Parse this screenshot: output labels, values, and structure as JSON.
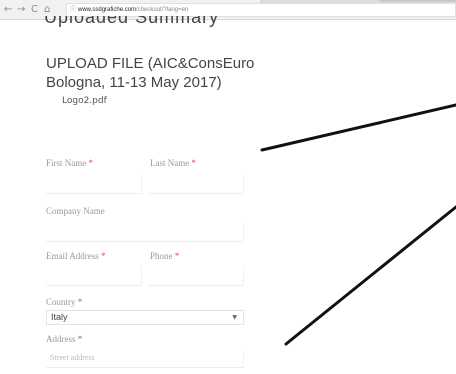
{
  "browser": {
    "back_icon": "←",
    "forward_icon": "→",
    "reload_icon": "C",
    "home_icon": "⌂",
    "info_icon": "ⓘ",
    "url_domain": "www.ssdgrafiche.com",
    "url_path": "/checkout/?lang=en"
  },
  "page": {
    "cut_title": "Uploaded Summary",
    "upload_title": "UPLOAD FILE (AIC&ConsEuro Bologna, 11-13 May 2017)",
    "file_name": "Logo2.pdf"
  },
  "form": {
    "first_name_label": "First Name",
    "last_name_label": "Last Name",
    "company_label": "Company Name",
    "email_label": "Email Address",
    "phone_label": "Phone",
    "country_label": "Country",
    "country_value": "Italy",
    "address_label": "Address",
    "address_placeholder": "Street address",
    "required_mark": "*"
  }
}
